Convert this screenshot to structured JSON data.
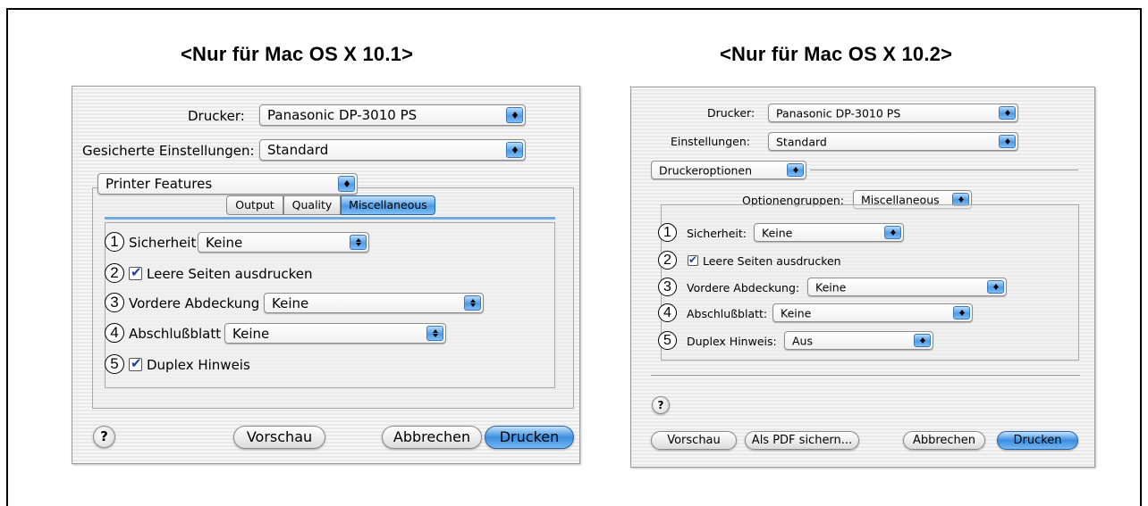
{
  "left": {
    "heading": "<Nur für Mac OS X 10.1>",
    "printer_label": "Drucker:",
    "printer_value": "Panasonic DP-3010 PS",
    "presets_label": "Gesicherte Einstellungen:",
    "presets_value": "Standard",
    "panel_value": "Printer Features",
    "tabs": [
      "Output",
      "Quality",
      "Miscellaneous"
    ],
    "selected_tab": "Miscellaneous",
    "rows": [
      {
        "num": "1",
        "label": "Sicherheit",
        "value": "Keine"
      },
      {
        "num": "2",
        "label": "Leere Seiten ausdrucken",
        "checked": true
      },
      {
        "num": "3",
        "label": "Vordere Abdeckung",
        "value": "Keine"
      },
      {
        "num": "4",
        "label": "Abschlußblatt",
        "value": "Keine"
      },
      {
        "num": "5",
        "label": "Duplex Hinweis",
        "checked": true
      }
    ],
    "help": "?",
    "preview_button": "Vorschau",
    "cancel_button": "Abbrechen",
    "print_button": "Drucken"
  },
  "right": {
    "heading": "<Nur für Mac OS X 10.2>",
    "printer_label": "Drucker:",
    "printer_value": "Panasonic DP-3010 PS",
    "presets_label": "Einstellungen:",
    "presets_value": "Standard",
    "panel_value": "Druckeroptionen",
    "groups_label": "Optionengruppen:",
    "groups_value": "Miscellaneous",
    "rows": [
      {
        "num": "1",
        "label": "Sicherheit:",
        "value": "Keine"
      },
      {
        "num": "2",
        "label": "Leere Seiten ausdrucken",
        "checked": true
      },
      {
        "num": "3",
        "label": "Vordere Abdeckung:",
        "value": "Keine"
      },
      {
        "num": "4",
        "label": "Abschlußblatt:",
        "value": "Keine"
      },
      {
        "num": "5",
        "label": "Duplex Hinweis:",
        "value": "Aus"
      }
    ],
    "help": "?",
    "preview_button": "Vorschau",
    "pdf_button": "Als PDF sichern...",
    "cancel_button": "Abbrechen",
    "print_button": "Drucken"
  },
  "colors": {
    "accent_blue": "#4b9ae4",
    "check_blue": "#1e3f9a",
    "dialog_bg": "#efefef"
  }
}
